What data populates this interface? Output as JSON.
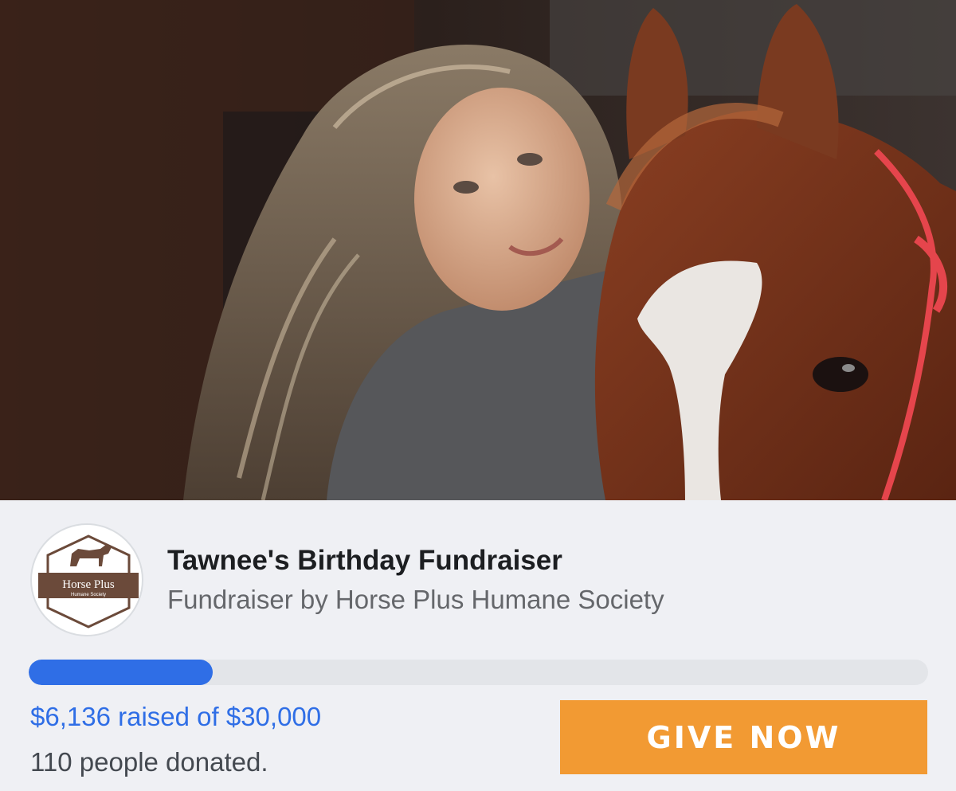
{
  "hero": {
    "image_description_icon": "photo-woman-with-horse-icon"
  },
  "organization": {
    "logo_icon": "horse-plus-logo-icon",
    "logo_name": "Horse Plus",
    "logo_tagline": "Humane Society"
  },
  "fundraiser": {
    "title": "Tawnee's Birthday Fundraiser",
    "subtitle": "Fundraiser by Horse Plus Humane Society",
    "raised_text": "$6,136 raised of $30,000",
    "raised_amount": 6136,
    "goal_amount": 30000,
    "progress_fraction": 0.2045,
    "donors_text": "110 people donated."
  },
  "actions": {
    "give_label": "GIVE NOW"
  },
  "colors": {
    "accent_blue": "#2f6ee6",
    "button_orange": "#f29a33",
    "background": "#eff0f4",
    "logo_brown": "#6b4a3a"
  }
}
